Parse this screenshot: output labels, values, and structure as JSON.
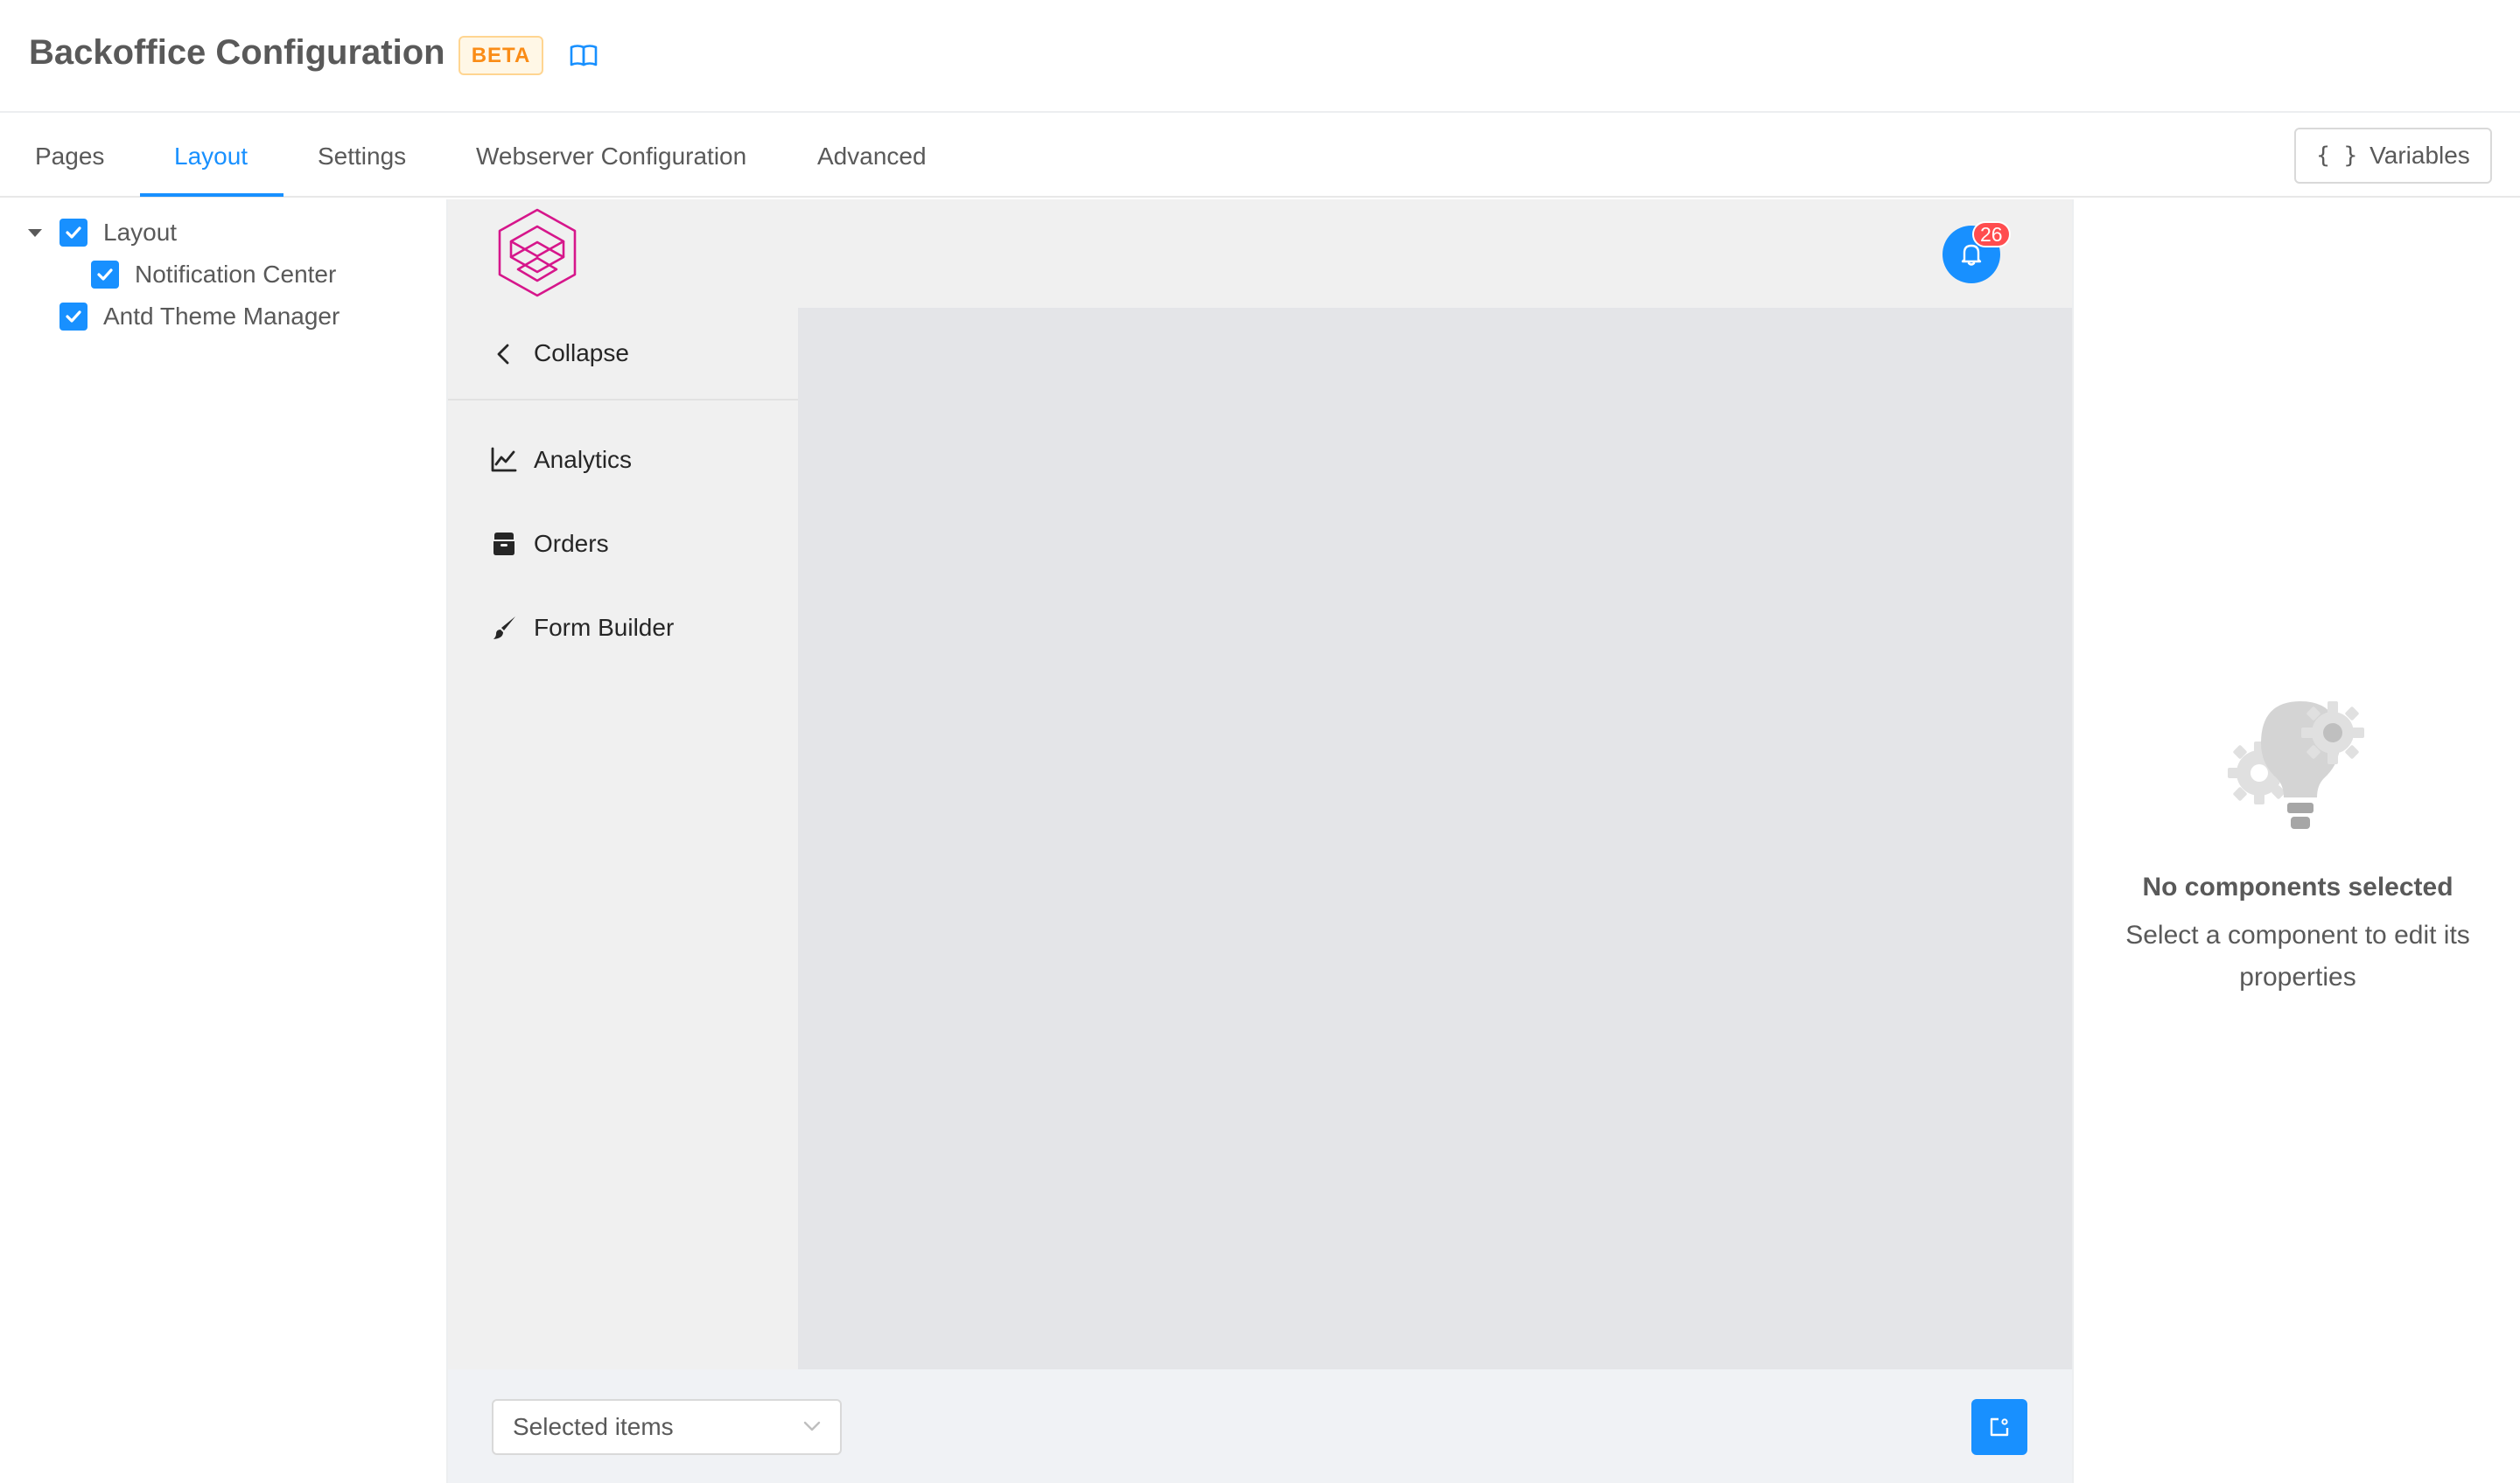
{
  "header": {
    "title": "Backoffice Configuration",
    "badge": "BETA",
    "docs_icon": "book-icon"
  },
  "tabs": [
    {
      "label": "Pages",
      "active": false
    },
    {
      "label": "Layout",
      "active": true
    },
    {
      "label": "Settings",
      "active": false
    },
    {
      "label": "Webserver Configuration",
      "active": false
    },
    {
      "label": "Advanced",
      "active": false
    }
  ],
  "variables_button": {
    "icon": "braces-icon",
    "icon_text": "{ }",
    "label": "Variables"
  },
  "tree": {
    "items": [
      {
        "label": "Layout",
        "checked": true,
        "expanded": true
      },
      {
        "label": "Notification Center",
        "checked": true
      },
      {
        "label": "Antd Theme Manager",
        "checked": true
      }
    ]
  },
  "preview": {
    "logo": "hexagon-logo",
    "notifications": {
      "icon": "bell-icon",
      "count": "26"
    },
    "sider": {
      "collapse_label": "Collapse",
      "items": [
        {
          "label": "Analytics",
          "icon": "line-chart-icon"
        },
        {
          "label": "Orders",
          "icon": "box-icon"
        },
        {
          "label": "Form Builder",
          "icon": "brush-icon"
        }
      ]
    },
    "footer": {
      "select_placeholder": "Selected items",
      "export_icon": "export-icon"
    }
  },
  "properties": {
    "empty_title": "No components selected",
    "empty_description": "Select a component to edit its properties",
    "illustration": "lightbulb-gears-icon"
  },
  "colors": {
    "primary": "#1890ff",
    "beta_text": "#fa8c16",
    "beta_bg": "#fff7e6",
    "badge": "#ff4d4f",
    "logo": "#d6168b"
  }
}
